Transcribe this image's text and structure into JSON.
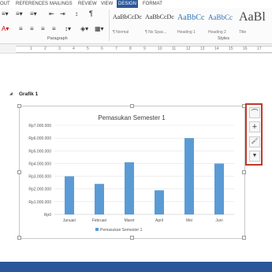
{
  "ribbon_tabs": [
    "OUT",
    "REFERENCES",
    "MAILINGS",
    "REVIEW",
    "VIEW",
    "DESIGN",
    "FORMAT"
  ],
  "ribbon_tab_active": "DESIGN",
  "paragraph_mark": "¶",
  "styles": [
    {
      "sample": "AaBbCcDc",
      "name": "¶ Normal"
    },
    {
      "sample": "AaBbCcDc",
      "name": "¶ No Spac..."
    },
    {
      "sample": "AaBbCc",
      "name": "Heading 1"
    },
    {
      "sample": "AaBbCc",
      "name": "Heading 2"
    },
    {
      "sample": "AaBl",
      "name": "Title"
    }
  ],
  "group_labels": {
    "paragraph": "Paragraph",
    "styles": "Styles"
  },
  "ruler_numbers": [
    "1",
    "2",
    "3",
    "4",
    "5",
    "6",
    "7",
    "8",
    "9",
    "10",
    "11",
    "12",
    "13",
    "14",
    "15",
    "16",
    "17"
  ],
  "heading": "Grafik 1",
  "collapse_glyph": "◢",
  "side_buttons": [
    {
      "icon": "layout-options-icon",
      "glyph": "⌒"
    },
    {
      "icon": "chart-elements-plus-icon",
      "glyph": "+"
    },
    {
      "icon": "chart-styles-brush-icon",
      "glyph": "🖌"
    },
    {
      "icon": "chart-filters-icon",
      "glyph": "▼"
    }
  ],
  "colors": {
    "bar": "#5b9bd5",
    "accent_blue": "#2b579a",
    "highlight_red": "#c0392b"
  },
  "chart_data": {
    "type": "bar",
    "title": "Pemasukan Semester 1",
    "categories": [
      "Januari",
      "Februari",
      "Maret",
      "April",
      "Mei",
      "Juni"
    ],
    "series": [
      {
        "name": "Pemasukan Semester 1",
        "values": [
          3000000,
          2400000,
          4100000,
          1900000,
          6000000,
          4000000
        ]
      }
    ],
    "ylim": [
      0,
      7000000
    ],
    "yticks": [
      "Rp0",
      "Rp1.000.000",
      "Rp2.000.000",
      "Rp3.000.000",
      "Rp4.000.000",
      "Rp5.000.000",
      "Rp6.000.000",
      "Rp7.000.000"
    ],
    "grid": true,
    "legend": "bottom"
  }
}
